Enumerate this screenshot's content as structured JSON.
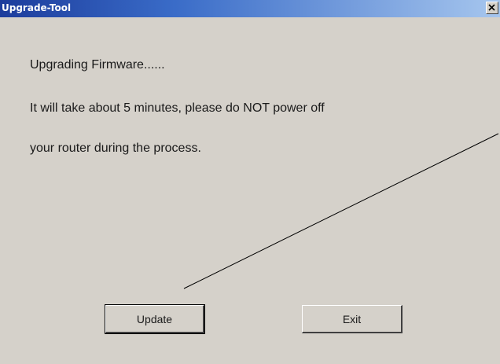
{
  "window": {
    "title": "Upgrade-Tool",
    "close_glyph": "x"
  },
  "message": {
    "line1": "Upgrading Firmware......",
    "line2": "It will take about 5 minutes, please do NOT power off",
    "line3": "your router during the process."
  },
  "buttons": {
    "update_label": "Update",
    "exit_label": "Exit"
  },
  "colors": {
    "titlebar_start": "#1c3c9c",
    "titlebar_end": "#a6c6ee",
    "window_bg": "#d5d1ca"
  },
  "icons": {
    "close": "close-icon"
  }
}
